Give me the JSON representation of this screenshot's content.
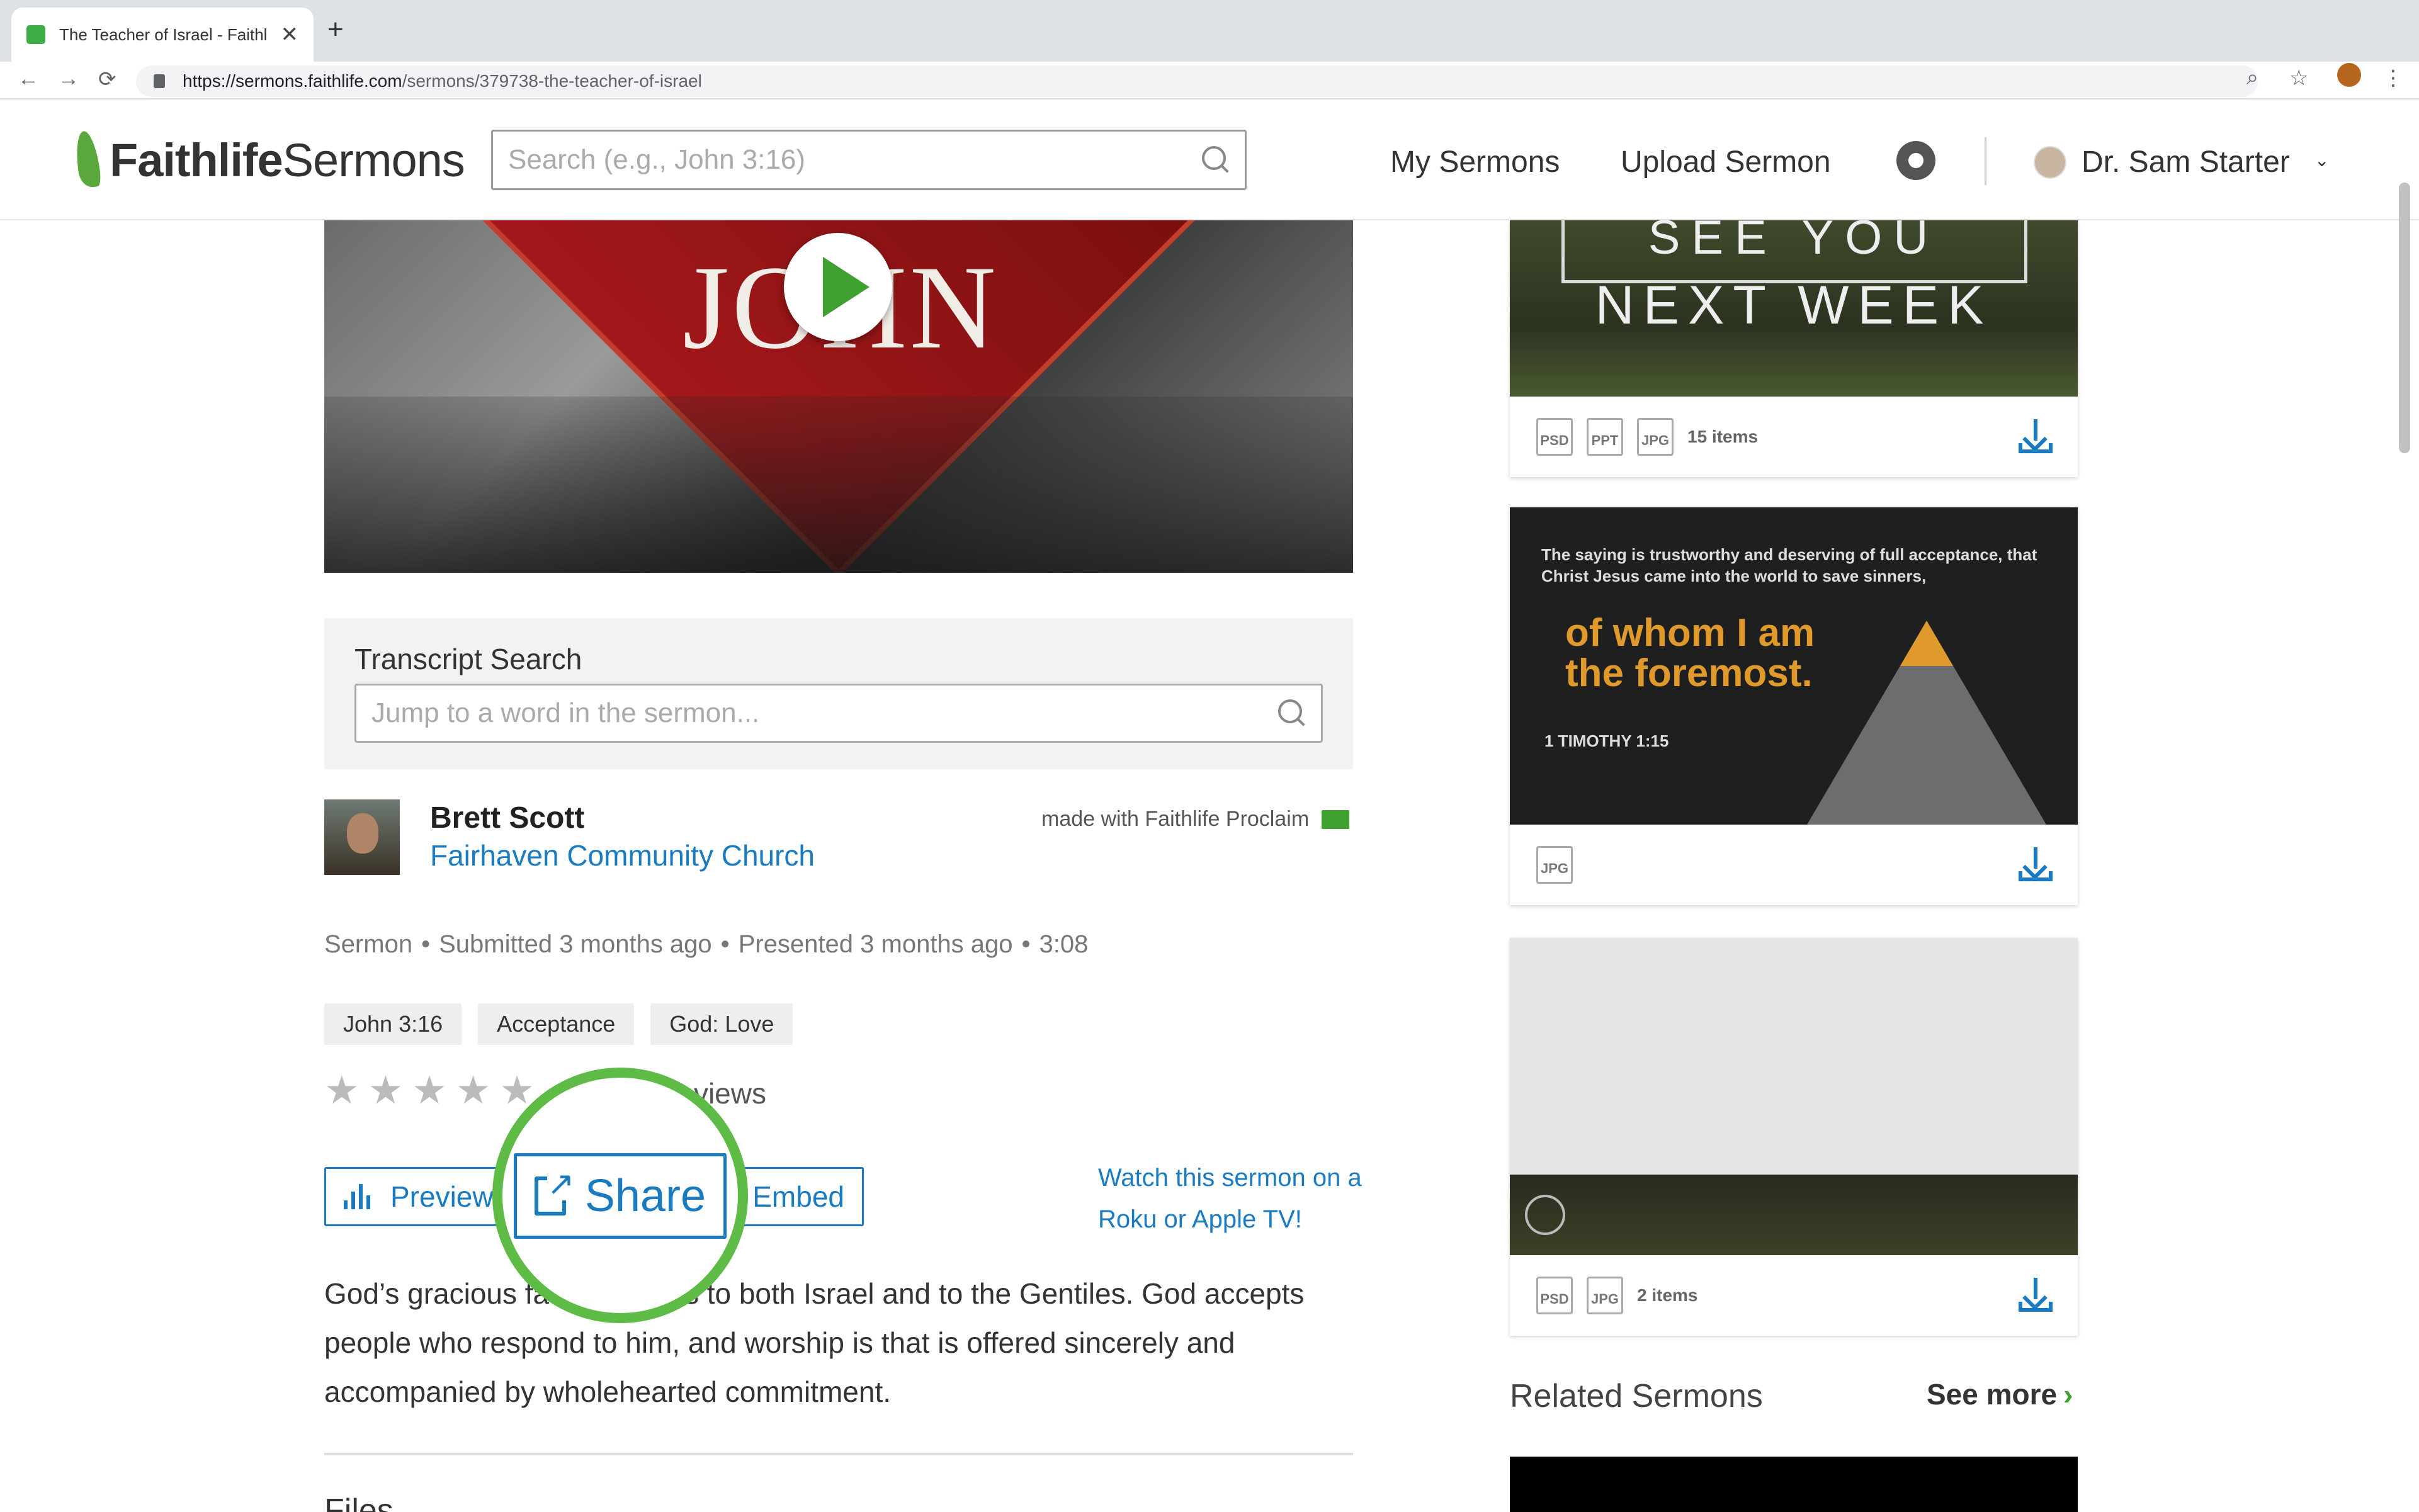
{
  "browser": {
    "tab_title": "The Teacher of Israel - Faithlife",
    "tab_close": "✕",
    "new_tab": "+",
    "url_host": "https://sermons.faithlife.com",
    "url_path": "/sermons/379738-the-teacher-of-israel",
    "back": "←",
    "forward": "→",
    "reload": "⟳",
    "zoom": "⌕",
    "bookmark": "☆",
    "menu": "⋮"
  },
  "header": {
    "logo_bold": "Faithlife",
    "logo_light": "Sermons",
    "search_placeholder": "Search (e.g., John 3:16)",
    "my_sermons": "My Sermons",
    "upload_sermon": "Upload Sermon",
    "user_name": "Dr. Sam Starter",
    "user_caret": "⌄"
  },
  "hero": {
    "title_art": "JOHN"
  },
  "transcript": {
    "label": "Transcript Search",
    "placeholder": "Jump to a word in the sermon..."
  },
  "author": {
    "name": "Brett Scott",
    "church": "Fairhaven Community Church",
    "made_with": "made with Faithlife Proclaim"
  },
  "meta": {
    "type": "Sermon",
    "submitted": "Submitted 3 months ago",
    "presented": "Presented 3 months ago",
    "duration": "3:08",
    "separator": "•"
  },
  "tags": [
    "John 3:16",
    "Acceptance",
    "God: Love"
  ],
  "rating": {
    "stars_filled": 0,
    "stars_total": 5,
    "star_glyph": "★",
    "views_text": "43 views"
  },
  "actions": {
    "preview": "Preview",
    "share": "Share",
    "embed": "Embed",
    "watch_on": "Watch this sermon on a Roku or Apple TV!"
  },
  "description": "God’s gracious favor extends to both Israel and to the Gentiles. God accepts people who respond to him, and worship is that is offered sincerely and accompanied by wholehearted commitment.",
  "files_heading": "Files",
  "sidebar": {
    "card1": {
      "line1": "SEE YOU",
      "line2": "NEXT WEEK",
      "formats": [
        "PSD",
        "PPT",
        "JPG"
      ],
      "count": "15 items"
    },
    "card2": {
      "small": "The saying is trustworthy and deserving of full acceptance, that Christ Jesus came into the world to save sinners,",
      "big": "of whom I am the foremost.",
      "ref": "1 TIMOTHY 1:15",
      "formats": [
        "JPG"
      ]
    },
    "card3": {
      "formats": [
        "PSD",
        "JPG"
      ],
      "count": "2 items"
    },
    "related_title": "Related Sermons",
    "see_more": "See more",
    "see_more_chev": "›"
  },
  "colors": {
    "accent_blue": "#1a7bc0",
    "brand_green": "#3fa12f",
    "highlight_ring": "#5dbb46"
  }
}
